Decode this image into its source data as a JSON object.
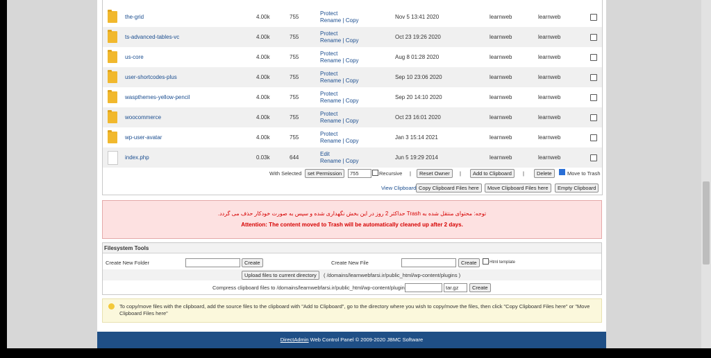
{
  "rows": [
    {
      "name": "the-grid",
      "size": "4.00k",
      "perm": "755",
      "act1": "Protect",
      "rename": "Rename",
      "copy": "Copy",
      "date": "Nov 5 13:41 2020",
      "owner": "learnweb",
      "group": "learnweb"
    },
    {
      "name": "ts-advanced-tables-vc",
      "size": "4.00k",
      "perm": "755",
      "act1": "Protect",
      "rename": "Rename",
      "copy": "Copy",
      "date": "Oct 23 19:26 2020",
      "owner": "learnweb",
      "group": "learnweb"
    },
    {
      "name": "us-core",
      "size": "4.00k",
      "perm": "755",
      "act1": "Protect",
      "rename": "Rename",
      "copy": "Copy",
      "date": "Aug 8 01:28 2020",
      "owner": "learnweb",
      "group": "learnweb"
    },
    {
      "name": "user-shortcodes-plus",
      "size": "4.00k",
      "perm": "755",
      "act1": "Protect",
      "rename": "Rename",
      "copy": "Copy",
      "date": "Sep 10 23:06 2020",
      "owner": "learnweb",
      "group": "learnweb"
    },
    {
      "name": "waspthemes-yellow-pencil",
      "size": "4.00k",
      "perm": "755",
      "act1": "Protect",
      "rename": "Rename",
      "copy": "Copy",
      "date": "Sep 20 14:10 2020",
      "owner": "learnweb",
      "group": "learnweb"
    },
    {
      "name": "woocommerce",
      "size": "4.00k",
      "perm": "755",
      "act1": "Protect",
      "rename": "Rename",
      "copy": "Copy",
      "date": "Oct 23 16:01 2020",
      "owner": "learnweb",
      "group": "learnweb"
    },
    {
      "name": "wp-user-avatar",
      "size": "4.00k",
      "perm": "755",
      "act1": "Protect",
      "rename": "Rename",
      "copy": "Copy",
      "date": "Jan 3 15:14 2021",
      "owner": "learnweb",
      "group": "learnweb"
    },
    {
      "name": "index.php",
      "size": "0.03k",
      "perm": "644",
      "act1": "Edit",
      "rename": "Rename",
      "copy": "Copy",
      "date": "Jun 5 19:29 2014",
      "owner": "learnweb",
      "group": "learnweb"
    }
  ],
  "selected": {
    "label": "With Selected",
    "set_permission": "set Permission",
    "perm_value": "755",
    "recursive": "Recursive",
    "reset_owner": "Reset Owner",
    "add_to_clipboard": "Add to Clipboard",
    "delete": "Delete",
    "move_to_trash": "Move to Trash"
  },
  "clipboard": {
    "view": "View Clipboard",
    "copy_here": "Copy Clipboard Files here",
    "move_here": "Move Clipboard Files here",
    "empty": "Empty Clipboard"
  },
  "warning": {
    "fa": "توجه: محتوای منتقل شده به Trash حداکثر 2 روز در این بخش نگهداری شده و سپس به صورت خودکار حذف می گردد.",
    "en": "Attention: The content moved to Trash will be automatically cleaned up after 2 days."
  },
  "fs": {
    "title": "Filesystem Tools",
    "new_folder": "Create New Folder",
    "create": "Create",
    "new_file": "Create New File",
    "html_template": "Html template",
    "upload": "Upload files to current directory",
    "path": "( /domains/learnwebfarsi.ir/public_html/wp-content/plugins )",
    "compress": "Compress clipboard files to /domains/learnwebfarsi.ir/public_html/wp-content/plugins",
    "format": "tar.gz"
  },
  "tip": "To copy/move files with the clipboard, add the source files to the clipboard with \"Add to Clipboard\", go to the directory where you wish to copy/move the files, then click \"Copy Clipboard Files here\" or \"Move Clipboard Files here\"",
  "footer": {
    "brand": "DirectAdmin",
    "text": " Web Control Panel © 2009-2020 JBMC Software"
  }
}
